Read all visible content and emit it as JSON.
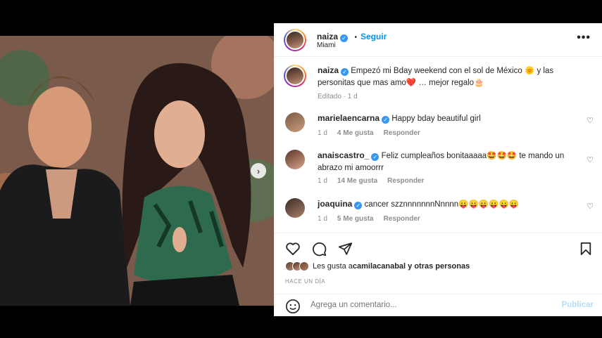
{
  "post": {
    "username": "naiza",
    "follow_label": "Seguir",
    "location": "Miami",
    "more_label": "•••"
  },
  "caption": {
    "username": "naiza",
    "text": "Empezó mi Bday weekend con el sol de México 🌞 y las personitas que mas amo❤️ … mejor regalo🎂",
    "edited_label": "Editado · 1 d"
  },
  "comments": [
    {
      "username": "marielaencarna",
      "text": "Happy bday beautiful girl",
      "age": "1 d",
      "likes": "4 Me gusta",
      "reply": "Responder"
    },
    {
      "username": "anaiscastro_",
      "text": "Feliz cumpleaños bonitaaaaa🤩🤩🤩 te mando un abrazo mi amoorrr",
      "age": "1 d",
      "likes": "14 Me gusta",
      "reply": "Responder"
    },
    {
      "username": "joaquina",
      "text": "cancer szznnnnnnnNnnnn😛😛😛😛😛😛",
      "age": "1 d",
      "likes": "5 Me gusta",
      "reply": "Responder"
    }
  ],
  "likes": {
    "prefix": "Les gusta a ",
    "user": "camilacanabal",
    "suffix": " y otras personas"
  },
  "time_ago": "HACE UN DÍA",
  "add_comment": {
    "placeholder": "Agrega un comentario...",
    "post_label": "Publicar"
  },
  "icons": {
    "verified": "verified-badge-icon",
    "heart": "heart-outline-icon",
    "comment": "comment-bubble-icon",
    "share": "paper-plane-icon",
    "save": "bookmark-icon",
    "emoji": "smiley-icon",
    "next": "chevron-right-icon"
  },
  "carousel": {
    "slides": 8,
    "active_index": 0
  },
  "colors": {
    "accent": "#0095f6",
    "verified": "#3897f0",
    "post_disabled": "#b2dffc",
    "muted": "#8e8e8e"
  }
}
